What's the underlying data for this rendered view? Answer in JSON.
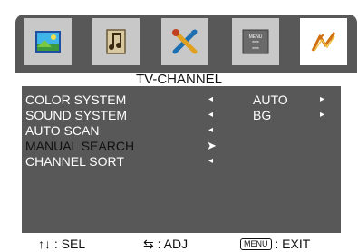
{
  "menu": {
    "title": "TV-CHANNEL",
    "tabs": [
      {
        "icon": "picture-icon",
        "active": false
      },
      {
        "icon": "sound-icon",
        "active": false
      },
      {
        "icon": "tools-icon",
        "active": false
      },
      {
        "icon": "menu-icon",
        "text": "MENU\n****\n****",
        "active": false
      },
      {
        "icon": "antenna-channel-icon",
        "active": true
      }
    ],
    "items": [
      {
        "label": "COLOR SYSTEM",
        "arrow": "◂",
        "value": "AUTO",
        "value_arrow": "▸"
      },
      {
        "label": "SOUND SYSTEM",
        "arrow": "◂",
        "value": "BG",
        "value_arrow": "▸"
      },
      {
        "label": "AUTO SCAN",
        "arrow": "◂",
        "value": "",
        "value_arrow": ""
      },
      {
        "label": "MANUAL SEARCH",
        "arrow": "➤",
        "value": "",
        "value_arrow": "",
        "selected": true
      },
      {
        "label": "CHANNEL SORT",
        "arrow": "◂",
        "value": "",
        "value_arrow": ""
      }
    ]
  },
  "footer": {
    "sel_icon": "↑↓",
    "sel_label": ": SEL",
    "adj_icon": "⇆",
    "adj_label": ": ADJ",
    "menu_key": "MENU",
    "exit_label": ": EXIT"
  },
  "colors": {
    "panel": "#585858",
    "tab": "#c8c8c8",
    "tab_active": "#ffffff"
  }
}
